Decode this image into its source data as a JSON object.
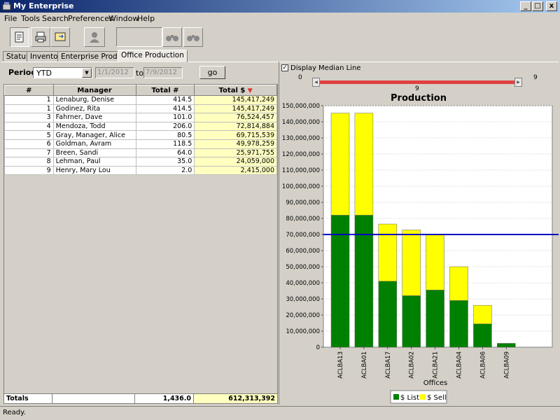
{
  "window": {
    "title": "My Enterprise",
    "min": "_",
    "max": "□",
    "close": "x"
  },
  "menu": [
    "File",
    "Tools",
    "Search",
    "Preferences",
    "Window",
    "Help"
  ],
  "tabs": [
    {
      "label": "Status",
      "active": false
    },
    {
      "label": "Inventory",
      "active": false
    },
    {
      "label": "Enterprise Production",
      "active": false
    },
    {
      "label": "Office Production",
      "active": true
    }
  ],
  "filters": {
    "period_label": "Period:",
    "period_value": "YTD",
    "date_from": "1/1/2012",
    "to_label": "to",
    "date_to": "7/9/2012",
    "go_label": "go"
  },
  "table": {
    "headers": [
      "#",
      "Manager",
      "Total #",
      "Total $"
    ],
    "rows": [
      [
        "1",
        "Lenaburg, Denise",
        "414.5",
        "145,417,249"
      ],
      [
        "1",
        "Godinez, Rita",
        "414.5",
        "145,417,249"
      ],
      [
        "3",
        "Fahrner, Dave",
        "101.0",
        "76,524,457"
      ],
      [
        "4",
        "Mendoza, Todd",
        "206.0",
        "72,814,884"
      ],
      [
        "5",
        "Gray, Manager, Alice",
        "80.5",
        "69,715,539"
      ],
      [
        "6",
        "Goldman, Avram",
        "118.5",
        "49,978,259"
      ],
      [
        "7",
        "Breen, Sandi",
        "64.0",
        "25,971,755"
      ],
      [
        "8",
        "Lehman, Paul",
        "35.0",
        "24,059,000"
      ],
      [
        "9",
        "Henry, Mary Lou",
        "2.0",
        "2,415,000"
      ]
    ],
    "totals_label": "Totals",
    "totals_count": "1,436.0",
    "totals_amount": "612,313,392"
  },
  "median": {
    "label": "Display Median Line",
    "checked": true,
    "value": 70000000
  },
  "slider": {
    "min": "0",
    "max": "9",
    "current": "9"
  },
  "status": "Ready.",
  "chart_data": {
    "type": "bar",
    "stacked": true,
    "title": "Production",
    "xlabel": "Offices",
    "ylabel": "",
    "categories": [
      "ACLBA13",
      "ACLBA01",
      "ACLBA17",
      "ACLBA02",
      "ACLBA21",
      "ACLBA04",
      "ACLBA06",
      "ACLBA09"
    ],
    "series": [
      {
        "name": "$ List",
        "color": "#008000",
        "values": [
          82000000,
          82000000,
          41000000,
          32000000,
          35500000,
          29000000,
          14500000,
          13500000
        ]
      },
      {
        "name": "$ Sell",
        "color": "#ffff00",
        "values": [
          63400000,
          63400000,
          35500000,
          40800000,
          34200000,
          21000000,
          11500000,
          10500000
        ]
      }
    ],
    "extra_last": {
      "category": "ACLBA09",
      "list": 2400000
    },
    "ylim": [
      0,
      150000000
    ],
    "yticks": [
      "0",
      "10,000,000",
      "20,000,000",
      "30,000,000",
      "40,000,000",
      "50,000,000",
      "60,000,000",
      "70,000,000",
      "80,000,000",
      "90,000,000",
      "100,000,000",
      "110,000,000",
      "120,000,000",
      "130,000,000",
      "140,000,000",
      "150,000,000"
    ],
    "median_color": "#0000c0",
    "legend_position": "bottom"
  }
}
